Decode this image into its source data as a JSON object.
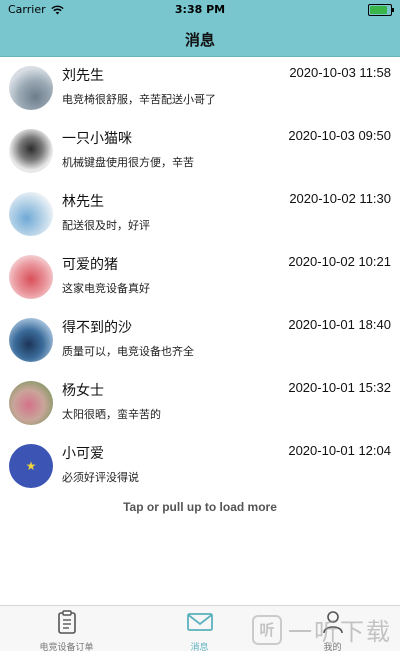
{
  "status_bar": {
    "carrier": "Carrier",
    "time": "3:38 PM"
  },
  "header": {
    "title": "消息"
  },
  "messages": [
    {
      "name": "刘先生",
      "time": "2020-10-03 11:58",
      "text": "电竞椅很舒服，辛苦配送小哥了"
    },
    {
      "name": "一只小猫咪",
      "time": "2020-10-03 09:50",
      "text": "机械键盘使用很方便，辛苦"
    },
    {
      "name": "林先生",
      "time": "2020-10-02 11:30",
      "text": "配送很及时，好评"
    },
    {
      "name": "可爱的猪",
      "time": "2020-10-02 10:21",
      "text": "这家电竞设备真好"
    },
    {
      "name": "得不到的沙",
      "time": "2020-10-01 18:40",
      "text": "质量可以，电竞设备也齐全"
    },
    {
      "name": "杨女士",
      "time": "2020-10-01 15:32",
      "text": "太阳很晒，蛮辛苦的"
    },
    {
      "name": "小可爱",
      "time": "2020-10-01 12:04",
      "text": "必须好评没得说"
    }
  ],
  "load_more": "Tap or pull up to load more",
  "tab_bar": {
    "tabs": [
      {
        "label": "电竞设备订单",
        "icon": "clipboard-icon"
      },
      {
        "label": "消息",
        "icon": "envelope-icon"
      },
      {
        "label": "我的",
        "icon": "person-icon"
      }
    ],
    "active_color": "#5bb1bd"
  },
  "watermark": {
    "logo": "听",
    "text": "一听下载"
  },
  "colors": {
    "header_bg": "#79c6cf"
  }
}
